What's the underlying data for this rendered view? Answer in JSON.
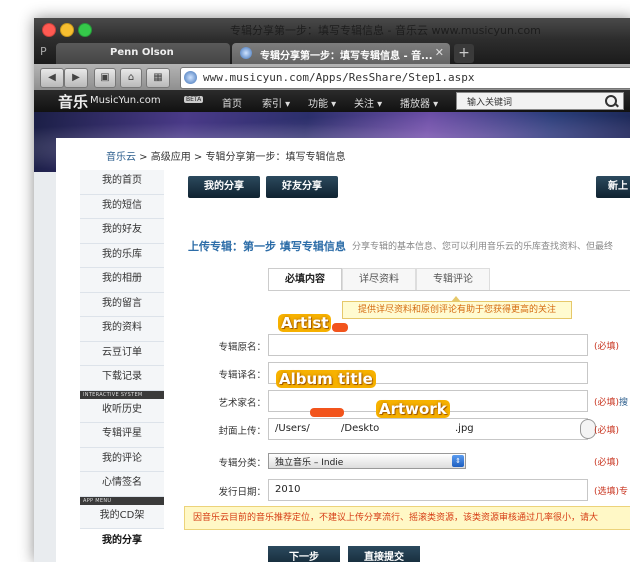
{
  "window": {
    "title": "专辑分享第一步：填写专辑信息 - 音乐云 www.musicyun.com"
  },
  "browser": {
    "tabs": [
      {
        "label": "Penn Olson",
        "close": ""
      },
      {
        "label": "专辑分享第一步：填写专辑信息 - 音...",
        "close": "✕"
      }
    ],
    "new_tab_label": "+",
    "url": "www.musicyun.com/Apps/ResShare/Step1.aspx",
    "back_glyph": "◀",
    "forward_glyph": "▶"
  },
  "site": {
    "logo_cn": "音乐",
    "logo_en": "MusicYun.com",
    "beta": "BETA",
    "nav": [
      "首页",
      "索引 ▾",
      "功能 ▾",
      "关注 ▾",
      "播放器 ▾"
    ],
    "search_placeholder": "输入关键词"
  },
  "breadcrumb": {
    "home": "音乐云",
    "rest": " > 高级应用 > 专辑分享第一步：填写专辑信息"
  },
  "sidebar": {
    "items": [
      "我的首页",
      "我的短信",
      "我的好友",
      "我的乐库",
      "我的相册",
      "我的留言",
      "我的资料",
      "云豆订单",
      "下载记录"
    ],
    "header1": "INTERACTIVE SYSTEM",
    "items2": [
      "收听历史",
      "专辑评星",
      "我的评论",
      "心情签名"
    ],
    "header2": "APP MENU",
    "items3": [
      "我的CD架"
    ],
    "active": "我的分享"
  },
  "main": {
    "btn_my_share": "我的分享",
    "btn_friend_share": "好友分享",
    "btn_new": "新上",
    "heading": "上传专辑：第一步 填写专辑信息",
    "subdesc": "分享专辑的基本信息、您可以利用音乐云的乐库查找资料、但最终",
    "tabs": [
      "必填内容",
      "详尽资料",
      "专辑评论"
    ],
    "tooltip": "提供详尽资料和原创评论有助于您获得更高的关注",
    "fields": {
      "album_name_label": "专辑原名：",
      "album_trans_label": "专辑译名：",
      "artist_label": "艺术家名：",
      "cover_label": "封面上传：",
      "category_label": "专辑分类：",
      "date_label": "发行日期：",
      "cover_value_a": "/Users/",
      "cover_value_b": "/Deskto",
      "cover_value_c": ".jpg",
      "category_value": "独立音乐 – Indie",
      "date_value": "2010"
    },
    "req": "(必填)",
    "req_search": "搜",
    "req_optional": "(选填)",
    "req_optional_extra": "专",
    "notice": "因音乐云目前的音乐推荐定位，不建议上传分享流行、摇滚类资源，该类资源审核通过几率很小，请大",
    "btn_next": "下一步",
    "btn_submit": "直接提交"
  },
  "overlays": {
    "artist": "Artist",
    "album_title": "Album title",
    "artwork": "Artwork"
  }
}
